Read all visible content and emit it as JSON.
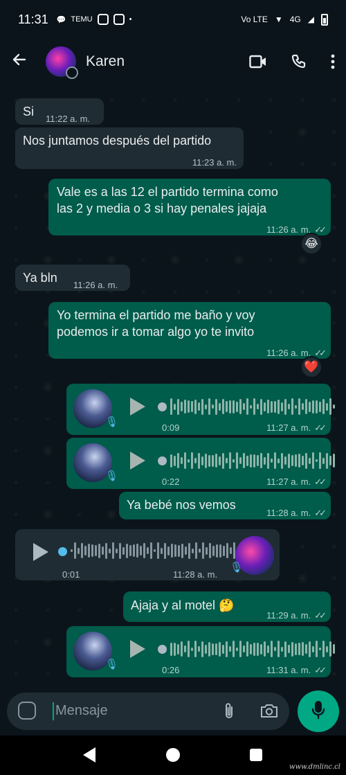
{
  "status_bar": {
    "time": "11:31",
    "network_label": "Vo LTE",
    "signal_label": "4G",
    "notif_label": "TEMU",
    "dot": "•"
  },
  "header": {
    "contact_name": "Karen"
  },
  "messages": [
    {
      "type": "text",
      "dir": "in",
      "text": "Si",
      "time": "11:22 a. m."
    },
    {
      "type": "text",
      "dir": "in",
      "text": "Nos juntamos después del partido",
      "time": "11:23 a. m."
    },
    {
      "type": "text",
      "dir": "out",
      "text_line1": "Vale es a las 12 el partido termina como",
      "text_line2": "las 2 y media o 3 si hay penales jajaja",
      "time": "11:26 a. m.",
      "reaction": "😂"
    },
    {
      "type": "text",
      "dir": "in",
      "text": "Ya bln",
      "time": "11:26 a. m."
    },
    {
      "type": "text",
      "dir": "out",
      "text_line1": "Yo termina el partido me baño y voy",
      "text_line2": "podemos ir a tomar algo yo te invito",
      "time": "11:26 a. m.",
      "reaction": "❤️"
    },
    {
      "type": "voice",
      "dir": "out",
      "duration": "0:09",
      "time": "11:27 a. m."
    },
    {
      "type": "voice",
      "dir": "out",
      "duration": "0:22",
      "time": "11:27 a. m."
    },
    {
      "type": "text",
      "dir": "out",
      "text": "Ya bebé nos vemos",
      "time": "11:28 a. m."
    },
    {
      "type": "voice",
      "dir": "in",
      "duration": "0:01",
      "time": "11:28 a. m."
    },
    {
      "type": "text",
      "dir": "out",
      "text": "Ajaja y al motel 🤔",
      "time": "11:29 a. m."
    },
    {
      "type": "voice",
      "dir": "out",
      "duration": "0:26",
      "time": "11:31 a. m."
    }
  ],
  "composer": {
    "placeholder": "Mensaje"
  },
  "watermark": "www.dmlinc.cl",
  "colors": {
    "incoming": "#202c33",
    "outgoing": "#005c4b",
    "accent": "#00a884",
    "background": "#0b141a"
  },
  "icons": [
    "back-arrow-icon",
    "video-call-icon",
    "phone-icon",
    "more-vert-icon",
    "emoji-icon",
    "attach-icon",
    "camera-icon",
    "mic-icon",
    "play-icon"
  ]
}
